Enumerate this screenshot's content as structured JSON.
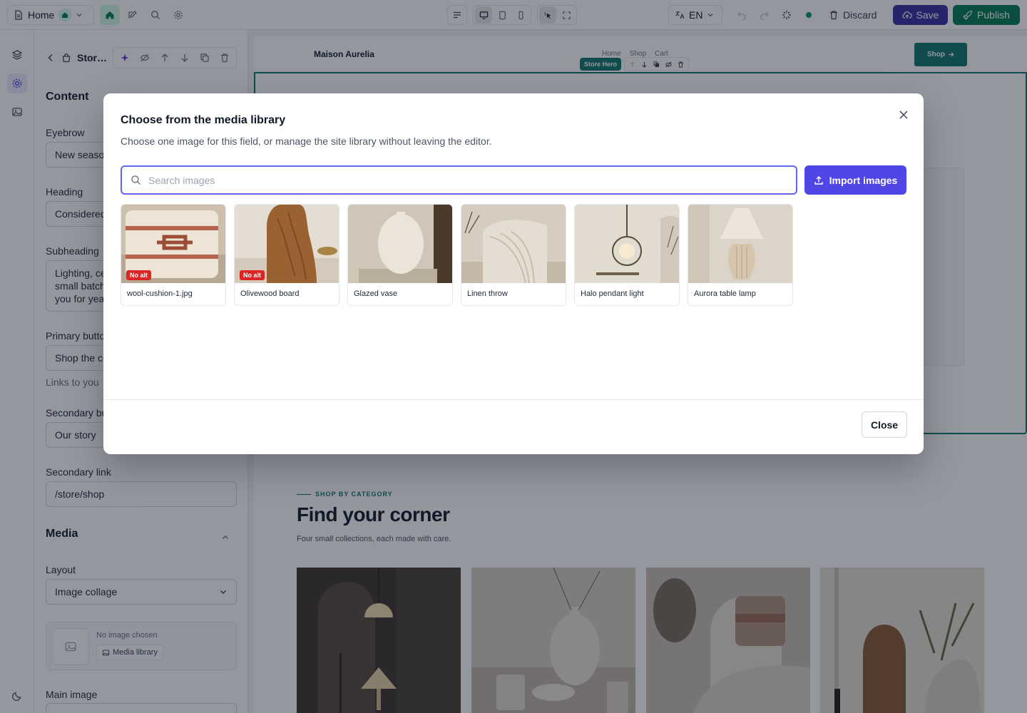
{
  "toolbar": {
    "page": "Home",
    "language": "EN",
    "discard": "Discard",
    "save": "Save",
    "publish": "Publish"
  },
  "inspector": {
    "block_title": "Stor…",
    "content_heading": "Content",
    "fields": {
      "eyebrow": {
        "label": "Eyebrow",
        "value": "New seaso"
      },
      "heading": {
        "label": "Heading",
        "value": "Considered"
      },
      "subheading": {
        "label": "Subheading",
        "value_lines": [
          "Lighting, ce",
          "small batch",
          "you for yea"
        ]
      },
      "primary_button": {
        "label": "Primary butto",
        "value": "Shop the co",
        "hint": "Links to you"
      },
      "secondary_button": {
        "label": "Secondary bu",
        "value": "Our story"
      },
      "secondary_link": {
        "label": "Secondary link",
        "value": "/store/shop"
      }
    },
    "media_heading": "Media",
    "layout": {
      "label": "Layout",
      "value": "Image collage"
    },
    "media_picker": {
      "empty_text": "No image chosen",
      "button": "Media library"
    },
    "main_image_label": "Main image"
  },
  "canvas": {
    "brand": "Maison Aurelia",
    "nav": [
      "Home",
      "Shop",
      "Cart"
    ],
    "shop_button": "Shop",
    "block_tag": "Store Hero",
    "category": {
      "eyebrow": "SHOP BY CATEGORY",
      "title": "Find your corner",
      "subtitle": "Four small collections, each made with care."
    }
  },
  "modal": {
    "title": "Choose from the media library",
    "description": "Choose one image for this field, or manage the site library without leaving the editor.",
    "search_placeholder": "Search images",
    "import_button": "Import images",
    "close_button": "Close",
    "images": [
      {
        "name": "wool-cushion-1.jpg",
        "badge": "No alt"
      },
      {
        "name": "Olivewood board",
        "badge": "No alt"
      },
      {
        "name": "Glazed vase",
        "badge": ""
      },
      {
        "name": "Linen throw",
        "badge": ""
      },
      {
        "name": "Halo pendant light",
        "badge": ""
      },
      {
        "name": "Aurora table lamp",
        "badge": ""
      }
    ]
  },
  "colors": {
    "brand_green": "#047857",
    "save_indigo": "#3730a3",
    "import_indigo": "#4f46e5",
    "badge_red": "#dc2626",
    "focus_ring": "#6366f1"
  }
}
